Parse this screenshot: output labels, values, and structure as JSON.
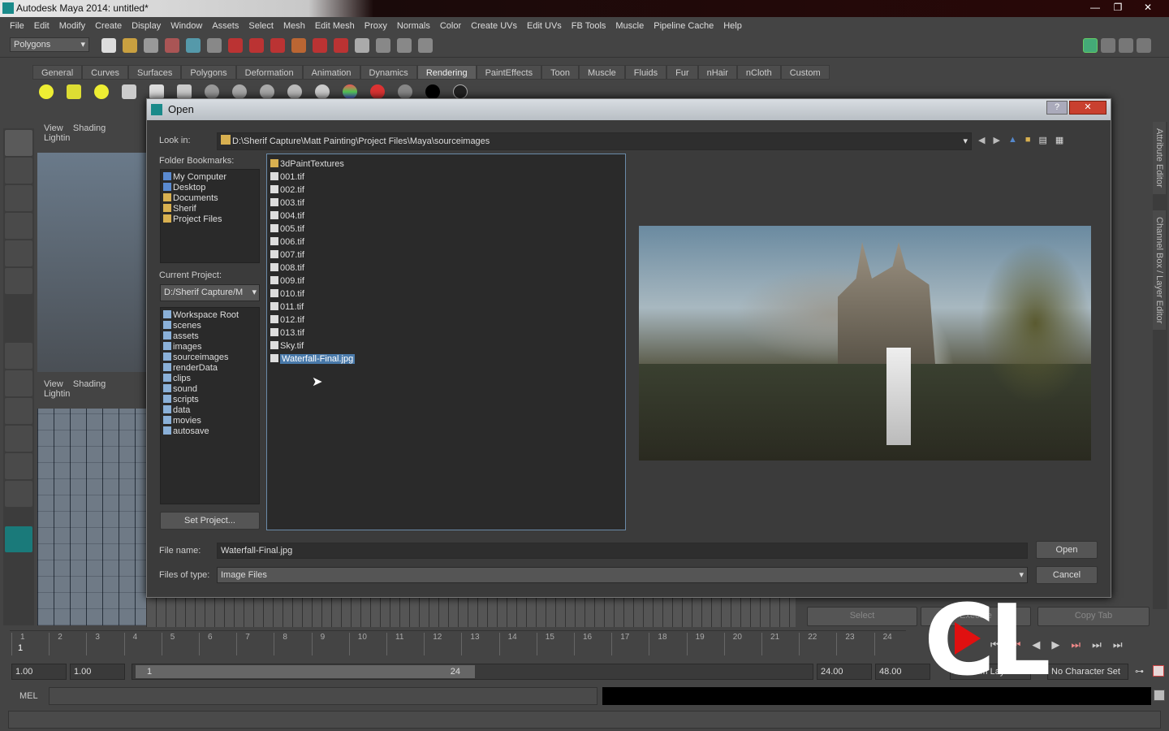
{
  "window": {
    "title": "Autodesk Maya 2014: untitled*"
  },
  "menu": [
    "File",
    "Edit",
    "Modify",
    "Create",
    "Display",
    "Window",
    "Assets",
    "Select",
    "Mesh",
    "Edit Mesh",
    "Proxy",
    "Normals",
    "Color",
    "Create UVs",
    "Edit UVs",
    "FB Tools",
    "Muscle",
    "Pipeline Cache",
    "Help"
  ],
  "status": {
    "mode": "Polygons"
  },
  "shelf_tabs": [
    "General",
    "Curves",
    "Surfaces",
    "Polygons",
    "Deformation",
    "Animation",
    "Dynamics",
    "Rendering",
    "PaintEffects",
    "Toon",
    "Muscle",
    "Fluids",
    "Fur",
    "nHair",
    "nCloth",
    "Custom"
  ],
  "shelf_active": "Rendering",
  "viewport": {
    "menu": [
      "View",
      "Shading",
      "Lightin"
    ]
  },
  "side_tabs": [
    "Attribute Editor",
    "Channel Box / Layer Editor"
  ],
  "dialog": {
    "title": "Open",
    "look_in_label": "Look in:",
    "look_in": "D:\\Sherif Capture\\Matt Painting\\Project Files\\Maya\\sourceimages",
    "bookmarks_label": "Folder Bookmarks:",
    "bookmarks": [
      "My Computer",
      "Desktop",
      "Documents",
      "Sherif",
      "Project Files"
    ],
    "current_project_label": "Current Project:",
    "current_project": "D:/Sherif Capture/M",
    "project_folders": [
      "Workspace Root",
      "scenes",
      "assets",
      "images",
      "sourceimages",
      "renderData",
      "clips",
      "sound",
      "scripts",
      "data",
      "movies",
      "autosave"
    ],
    "set_project": "Set Project...",
    "files": [
      "3dPaintTextures",
      "001.tif",
      "002.tif",
      "003.tif",
      "004.tif",
      "005.tif",
      "006.tif",
      "007.tif",
      "008.tif",
      "009.tif",
      "010.tif",
      "011.tif",
      "012.tif",
      "013.tif",
      "Sky.tif",
      "Waterfall-Final.jpg"
    ],
    "selected_file": "Waterfall-Final.jpg",
    "file_name_label": "File name:",
    "file_name": "Waterfall-Final.jpg",
    "file_type_label": "Files of type:",
    "file_type": "Image Files",
    "open": "Open",
    "cancel": "Cancel",
    "help": "?"
  },
  "timeline": {
    "ticks": [
      "1",
      "2",
      "3",
      "4",
      "5",
      "6",
      "7",
      "8",
      "9",
      "10",
      "11",
      "12",
      "13",
      "14",
      "15",
      "16",
      "17",
      "18",
      "19",
      "20",
      "21",
      "22",
      "23",
      "24"
    ],
    "current": "1"
  },
  "range": {
    "start": "1.00",
    "start2": "1.00",
    "slider_start": "1",
    "slider_end": "24",
    "end": "24.00",
    "end2": "48.00",
    "anim_layer": "No Anim Layer",
    "char_set": "No Character Set"
  },
  "buttons": {
    "select": "Select",
    "execute": "Execute",
    "copy_tab": "Copy Tab"
  },
  "mel": {
    "label": "MEL"
  },
  "watermark": "CL"
}
